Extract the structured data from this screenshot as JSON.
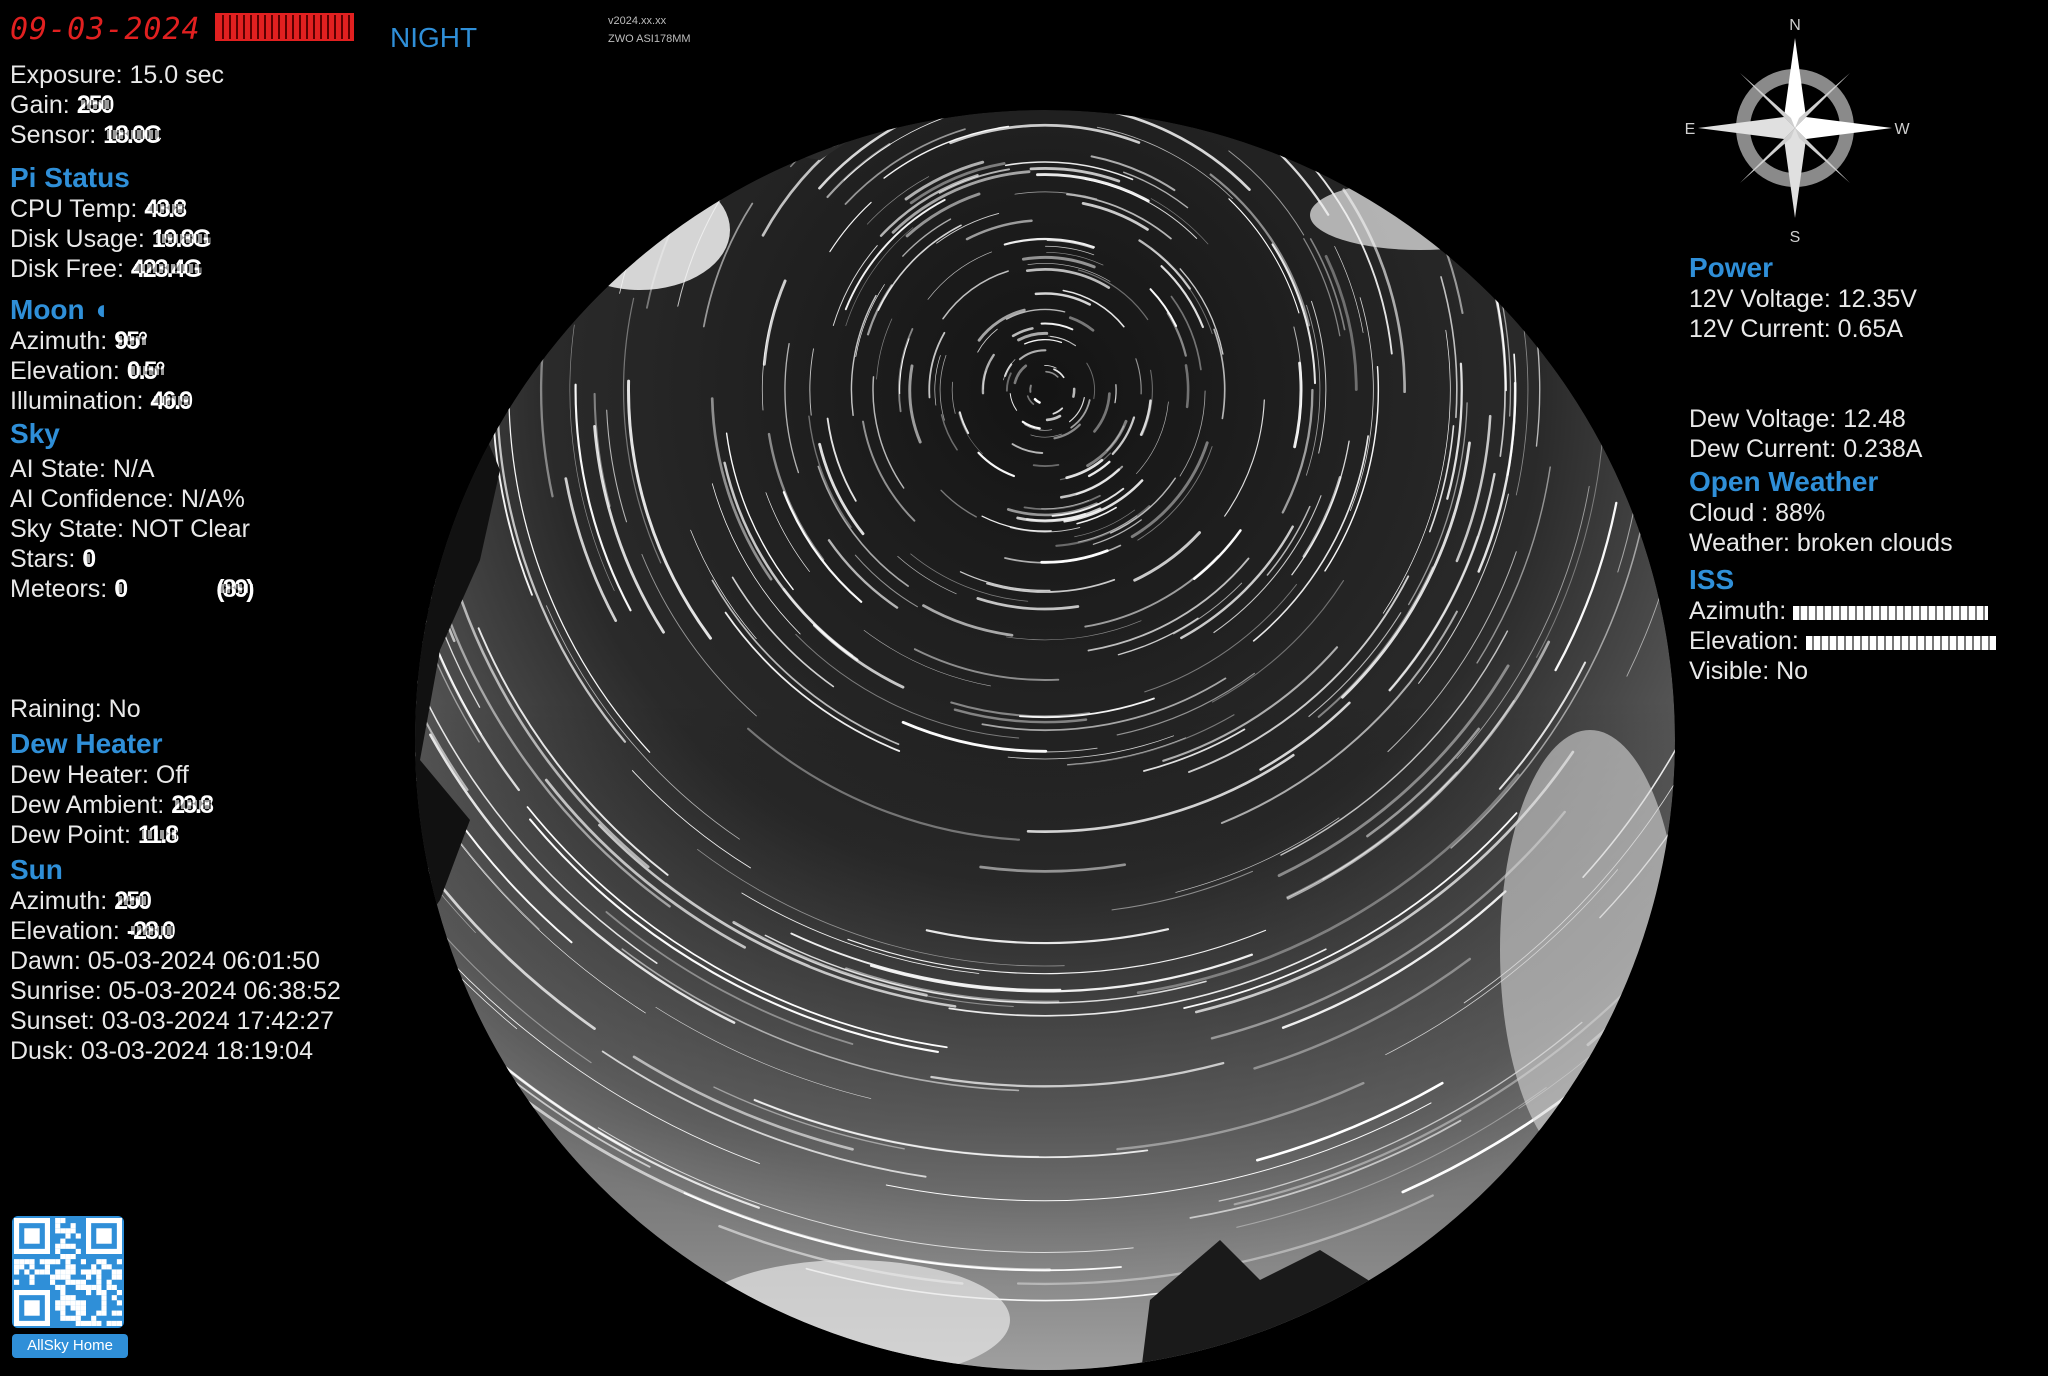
{
  "header": {
    "date": "09-03-2024",
    "mode": "NIGHT",
    "version": "v2024.xx.xx",
    "camera": "ZWO ASI178MM"
  },
  "camera": {
    "exposure": "Exposure: 15.0 sec",
    "gain_label": "Gain:",
    "gain_value": "250",
    "sensor_label": "Sensor:",
    "sensor_value": "18.0C"
  },
  "pi_status": {
    "heading": "Pi Status",
    "cpu_label": "CPU Temp:",
    "cpu_value": "43.8",
    "disk_usage_label": "Disk Usage:",
    "disk_usage_value": "19.8G",
    "disk_free_label": "Disk Free:",
    "disk_free_value": "423.4G"
  },
  "moon": {
    "heading": "Moon",
    "azimuth_label": "Azimuth:",
    "azimuth_value": "95°",
    "elevation_label": "Elevation:",
    "elevation_value": "0.5°",
    "illumination_label": "Illumination:",
    "illumination_value": "46.9"
  },
  "sky": {
    "heading": "Sky",
    "ai_state": "AI State: N/A",
    "ai_confidence": "AI Confidence: N/A%",
    "sky_state": "Sky State: NOT Clear",
    "stars_label": "Stars:",
    "stars_value": "0",
    "meteors_label": "Meteors:",
    "meteors_value": "0",
    "meteors_extra": "(89)",
    "raining": "Raining: No"
  },
  "dew_heater": {
    "heading": "Dew Heater",
    "heater": "Dew Heater: Off",
    "ambient_label": "Dew Ambient:",
    "ambient_value": "23.8",
    "point_label": "Dew Point:",
    "point_value": "11.8"
  },
  "sun": {
    "heading": "Sun",
    "azimuth_label": "Azimuth:",
    "azimuth_value": "250",
    "elevation_label": "Elevation:",
    "elevation_value": "-28.0",
    "dawn": "Dawn: 05-03-2024 06:01:50",
    "sunrise": "Sunrise: 05-03-2024 06:38:52",
    "sunset": "Sunset: 03-03-2024 17:42:27",
    "dusk": "Dusk: 03-03-2024 18:19:04"
  },
  "power": {
    "heading": "Power",
    "voltage_12v": "12V Voltage: 12.35V",
    "current_12v": "12V Current: 0.65A",
    "dew_voltage": "Dew Voltage: 12.48",
    "dew_current": "Dew Current: 0.238A"
  },
  "open_weather": {
    "heading": "Open Weather",
    "cloud": "Cloud : 88%",
    "weather": "Weather: broken clouds"
  },
  "iss": {
    "heading": "ISS",
    "azimuth_label": "Azimuth:",
    "elevation_label": "Elevation:",
    "visible": "Visible: No"
  },
  "compass": {
    "n": "N",
    "s": "S",
    "e": "E",
    "w": "W"
  },
  "qr": {
    "label": "AllSky Home"
  }
}
